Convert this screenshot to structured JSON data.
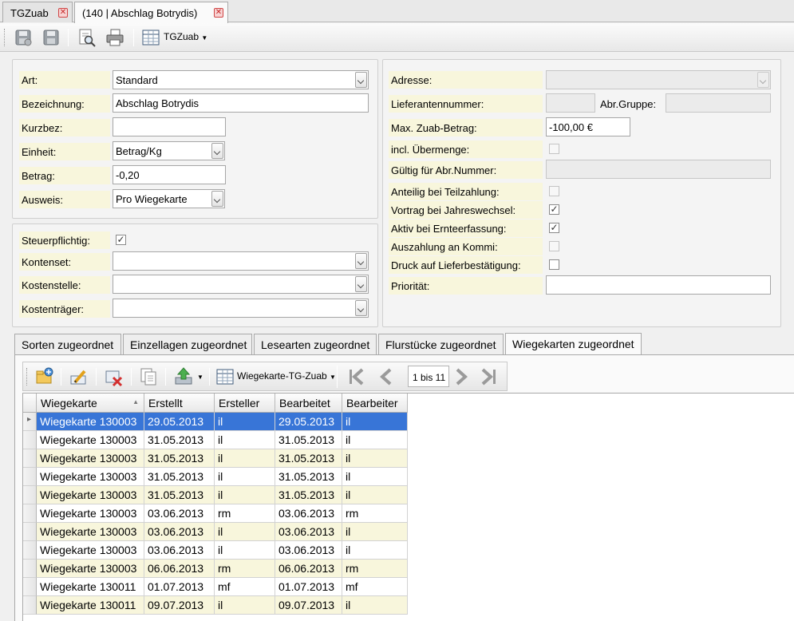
{
  "doc_tabs": [
    {
      "label": "TGZuab",
      "active": false
    },
    {
      "label": "(140 | Abschlag Botrydis)",
      "active": true
    }
  ],
  "toolbar": {
    "dropdown_label": "TGZuab"
  },
  "form_left": {
    "art": {
      "label": "Art:",
      "value": "Standard"
    },
    "bezeichnung": {
      "label": "Bezeichnung:",
      "value": "Abschlag Botrydis"
    },
    "kurzbez": {
      "label": "Kurzbez:",
      "value": ""
    },
    "einheit": {
      "label": "Einheit:",
      "value": "Betrag/Kg"
    },
    "betrag": {
      "label": "Betrag:",
      "value": "-0,20"
    },
    "ausweis": {
      "label": "Ausweis:",
      "value": "Pro Wiegekarte"
    }
  },
  "form_accounting": {
    "steuerpflichtig": {
      "label": "Steuerpflichtig:",
      "checked": true
    },
    "kontenset": {
      "label": "Kontenset:",
      "value": ""
    },
    "kostenstelle": {
      "label": "Kostenstelle:",
      "value": ""
    },
    "kostentraeger": {
      "label": "Kostenträger:",
      "value": ""
    }
  },
  "form_right": {
    "adresse": {
      "label": "Adresse:",
      "value": ""
    },
    "lieferantennummer": {
      "label": "Lieferantennummer:",
      "value": ""
    },
    "abr_gruppe": {
      "label": "Abr.Gruppe:",
      "value": ""
    },
    "max_betrag": {
      "label": "Max. Zuab-Betrag:",
      "value": "-100,00 €"
    },
    "incl_uebermenge": {
      "label": "incl. Übermenge:",
      "checked": false
    },
    "gueltig": {
      "label": "Gültig für Abr.Nummer:",
      "value": ""
    },
    "anteilig": {
      "label": "Anteilig bei Teilzahlung:",
      "checked": false
    },
    "vortrag": {
      "label": "Vortrag bei Jahreswechsel:",
      "checked": true
    },
    "aktiv": {
      "label": "Aktiv bei Ernteerfassung:",
      "checked": true
    },
    "auszahlung": {
      "label": "Auszahlung an Kommi:",
      "checked": false
    },
    "druck": {
      "label": "Druck auf Lieferbestätigung:",
      "checked": false
    },
    "prioritaet": {
      "label": "Priorität:",
      "value": ""
    }
  },
  "sub_tabs": [
    {
      "label": "Sorten zugeordnet",
      "active": false
    },
    {
      "label": "Einzellagen zugeordnet",
      "active": false
    },
    {
      "label": "Lesearten zugeordnet",
      "active": false
    },
    {
      "label": "Flurstücke zugeordnet",
      "active": false
    },
    {
      "label": "Wiegekarten zugeordnet",
      "active": true
    }
  ],
  "grid_toolbar": {
    "dropdown_label": "Wiegekarte-TG-Zuab",
    "pager": "1 bis 11"
  },
  "grid": {
    "columns": [
      "Wiegekarte",
      "Erstellt",
      "Ersteller",
      "Bearbeitet",
      "Bearbeiter"
    ],
    "rows": [
      [
        "Wiegekarte 130003",
        "29.05.2013",
        "il",
        "29.05.2013",
        "il"
      ],
      [
        "Wiegekarte 130003",
        "31.05.2013",
        "il",
        "31.05.2013",
        "il"
      ],
      [
        "Wiegekarte 130003",
        "31.05.2013",
        "il",
        "31.05.2013",
        "il"
      ],
      [
        "Wiegekarte 130003",
        "31.05.2013",
        "il",
        "31.05.2013",
        "il"
      ],
      [
        "Wiegekarte 130003",
        "31.05.2013",
        "il",
        "31.05.2013",
        "il"
      ],
      [
        "Wiegekarte 130003",
        "03.06.2013",
        "rm",
        "03.06.2013",
        "rm"
      ],
      [
        "Wiegekarte 130003",
        "03.06.2013",
        "il",
        "03.06.2013",
        "il"
      ],
      [
        "Wiegekarte 130003",
        "03.06.2013",
        "il",
        "03.06.2013",
        "il"
      ],
      [
        "Wiegekarte 130003",
        "06.06.2013",
        "rm",
        "06.06.2013",
        "rm"
      ],
      [
        "Wiegekarte 130011",
        "01.07.2013",
        "mf",
        "01.07.2013",
        "mf"
      ],
      [
        "Wiegekarte 130011",
        "09.07.2013",
        "il",
        "09.07.2013",
        "il"
      ]
    ],
    "selected_row": 0,
    "sort": "ascending"
  },
  "colors": {
    "label_bg": "#f8f6dc",
    "selection": "#3875d7",
    "close_icon": "#c62828"
  }
}
